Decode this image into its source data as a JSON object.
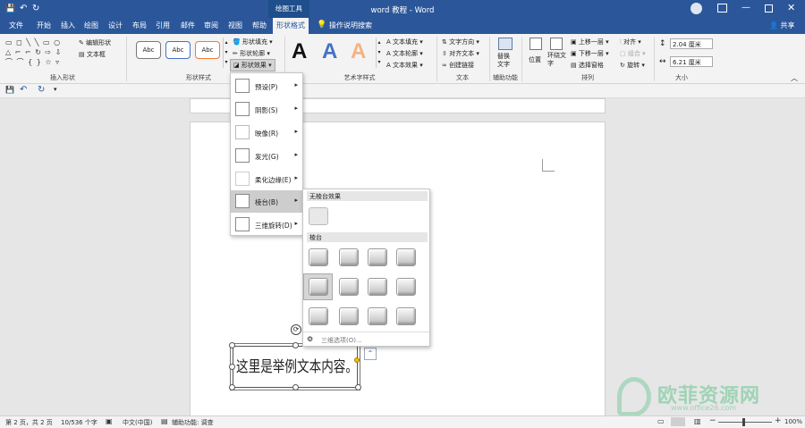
{
  "window": {
    "title": "word 教程 - Word",
    "context_tool": "绘图工具"
  },
  "tabs": [
    "文件",
    "开始",
    "插入",
    "绘图",
    "设计",
    "布局",
    "引用",
    "邮件",
    "审阅",
    "视图",
    "帮助",
    "形状格式"
  ],
  "tell_me": "操作说明搜索",
  "share": "共享",
  "ribbon": {
    "insert_shapes": {
      "label": "插入形状",
      "edit_shape": "编辑形状",
      "text_box": "文本框"
    },
    "shape_styles": {
      "label": "形状样式",
      "sample": "Abc",
      "fill": "形状填充",
      "outline": "形状轮廓",
      "effects": "形状效果"
    },
    "wordart": {
      "label": "艺术字样式",
      "sample": "A",
      "text_fill": "文本填充",
      "text_outline": "文本轮廓",
      "text_effects": "文本效果"
    },
    "text": {
      "label": "文本",
      "direction": "文字方向",
      "align": "对齐文本",
      "link": "创建链接"
    },
    "accessibility": {
      "label": "辅助功能",
      "alt_text": "替换\n文字"
    },
    "arrange": {
      "label": "排列",
      "position": "位置",
      "wrap": "环绕文\n字",
      "bring_forward": "上移一层",
      "send_backward": "下移一层",
      "selection_pane": "选择窗格",
      "align": "对齐",
      "group": "组合",
      "rotate": "旋转"
    },
    "size": {
      "label": "大小",
      "height": "2.04 厘米",
      "width": "6.21 厘米"
    }
  },
  "effects_menu": {
    "items": [
      "预设(P)",
      "阴影(S)",
      "映像(R)",
      "发光(G)",
      "柔化边缘(E)",
      "棱台(B)",
      "三维旋转(D)"
    ]
  },
  "bevel_panel": {
    "none_header": "无棱台效果",
    "bevel_header": "棱台",
    "options_link": "三维选项(O)..."
  },
  "textbox": {
    "text": "这里是举例文本内容。"
  },
  "status": {
    "page": "第 2 页，共 2 页",
    "words": "10/536 个字",
    "language": "中文(中国)",
    "accessibility": "辅助功能: 调查",
    "zoom": "100%"
  },
  "watermark": {
    "brand": "欧菲资源网",
    "url": "www.office26.com"
  }
}
